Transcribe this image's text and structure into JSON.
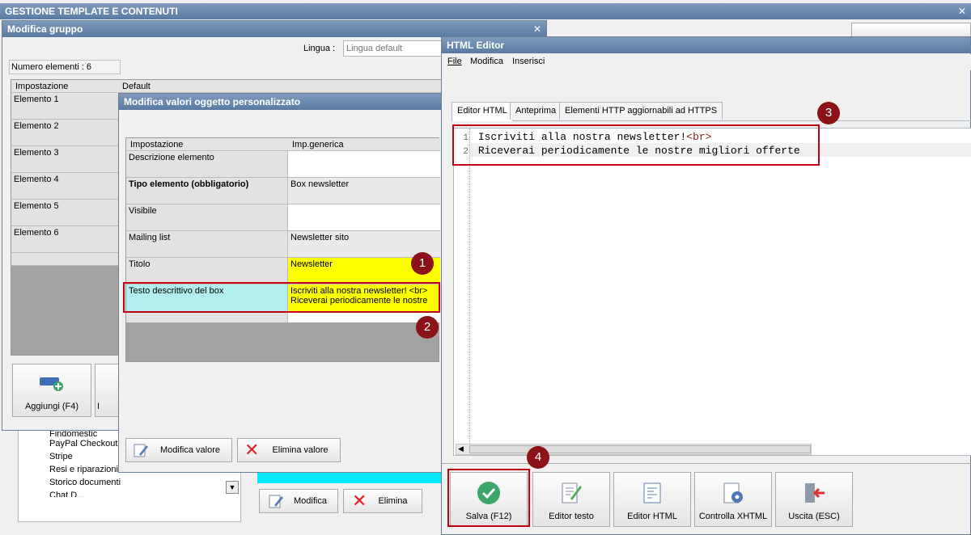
{
  "main_window": {
    "title": "GESTIONE TEMPLATE E CONTENUTI"
  },
  "group_window": {
    "title": "Modifica gruppo",
    "lingua_label": "Lingua :",
    "lingua_placeholder": "Lingua default",
    "count_label": "Numero elementi : 6",
    "columns": [
      "Impostazione",
      "Default"
    ],
    "rows": [
      "Elemento 1",
      "Elemento 2",
      "Elemento 3",
      "Elemento 4",
      "Elemento 5",
      "Elemento 6"
    ],
    "add_button": "Aggiungi (F4)",
    "add_button_next_partial": "I"
  },
  "background_list": {
    "items": [
      "Findomestic",
      "PayPal Checkout",
      "Stripe",
      "Resi e riparazioni",
      "Storico documenti",
      "Chat D..."
    ]
  },
  "background_buttons": {
    "modifica": "Modifica",
    "elimina": "Elimina"
  },
  "props_window": {
    "title": "Modifica valori oggetto personalizzato",
    "columns": [
      "Impostazione",
      "Imp.generica"
    ],
    "rows": [
      {
        "label": "Descrizione elemento",
        "value": "",
        "bold": false
      },
      {
        "label": "Tipo elemento (obbligatorio)",
        "value": "Box newsletter",
        "bold": true
      },
      {
        "label": "Visibile",
        "value": "",
        "bold": false
      },
      {
        "label": "Mailing list",
        "value": "Newsletter sito",
        "bold": false
      },
      {
        "label": "Titolo",
        "value": "Newsletter",
        "bold": false
      },
      {
        "label": "Testo descrittivo del box",
        "value_line1": "Iscriviti alla nostra newsletter! <br>",
        "value_line2": "Riceverai periodicamente le nostre",
        "bold": false
      }
    ],
    "modifica_button": "Modifica valore",
    "elimina_button": "Elimina valore"
  },
  "html_editor": {
    "title": "HTML Editor",
    "menu": [
      "File",
      "Modifica",
      "Inserisci"
    ],
    "tabs": [
      "Editor HTML",
      "Anteprima",
      "Elementi HTTP aggiornabili ad HTTPS"
    ],
    "code_lines": [
      {
        "num": "1",
        "text": "Iscriviti alla nostra newsletter!",
        "tag": "<br>"
      },
      {
        "num": "2",
        "text": "Riceverai periodicamente le nostre migliori offerte",
        "tag": ""
      }
    ],
    "buttons": [
      "Salva (F12)",
      "Editor testo",
      "Editor HTML",
      "Controlla XHTML",
      "Uscita (ESC)"
    ]
  },
  "badges": [
    "1",
    "2",
    "3",
    "4"
  ],
  "colors": {
    "highlight_yellow": "#ffff00",
    "highlight_cyan": "#b2eef0",
    "accent_red": "#c00010",
    "badge_red": "#8b1216",
    "save_green": "#3aa66a"
  }
}
